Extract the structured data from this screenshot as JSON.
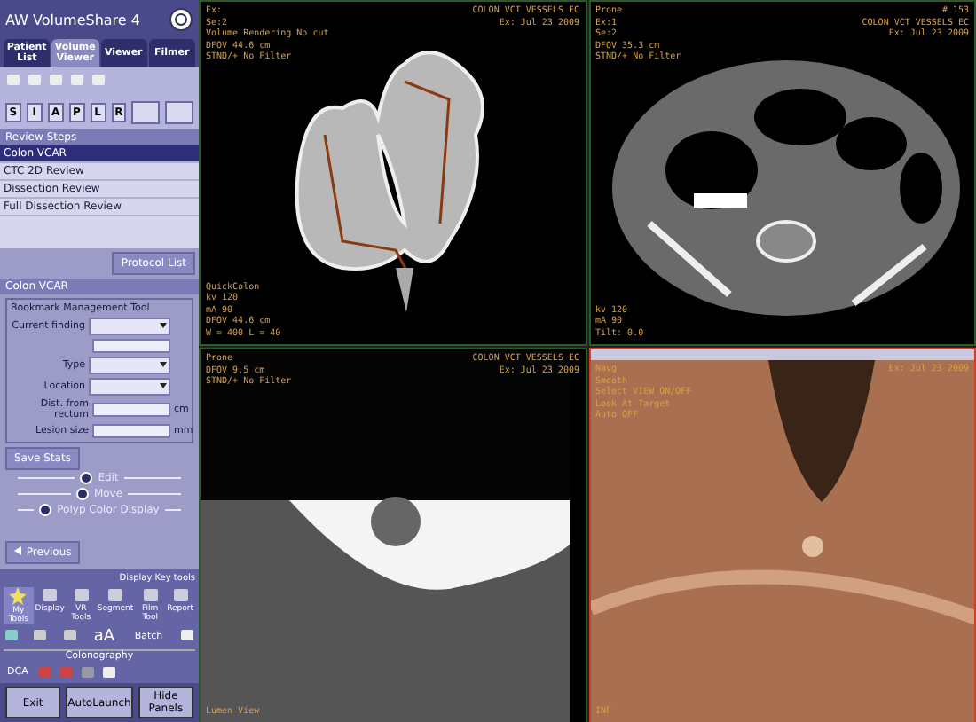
{
  "app": {
    "title": "AW VolumeShare 4"
  },
  "tabs": [
    {
      "label": "Patient List",
      "selected": false
    },
    {
      "label": "Volume Viewer",
      "selected": true
    },
    {
      "label": "Viewer",
      "selected": false
    },
    {
      "label": "Filmer",
      "selected": false
    }
  ],
  "orientation_buttons": [
    {
      "label": "S",
      "selected": false
    },
    {
      "label": "I",
      "selected": false
    },
    {
      "label": "A",
      "selected": false
    },
    {
      "label": "P",
      "selected": false
    },
    {
      "label": "L",
      "selected": false
    },
    {
      "label": "R",
      "selected": false
    }
  ],
  "review_steps": {
    "title": "Review Steps",
    "items": [
      {
        "label": "Colon VCAR",
        "selected": true
      },
      {
        "label": "CTC 2D Review",
        "selected": false
      },
      {
        "label": "Dissection Review",
        "selected": false
      },
      {
        "label": "Full Dissection Review",
        "selected": false
      }
    ]
  },
  "protocol_button": "Protocol List",
  "section_title": "Colon VCAR",
  "bookmark_tool": {
    "title": "Bookmark Management Tool",
    "fields": [
      {
        "kind": "select",
        "label": "Current finding"
      },
      {
        "kind": "input"
      },
      {
        "kind": "select",
        "label": "Type"
      },
      {
        "kind": "select",
        "label": "Location"
      },
      {
        "kind": "input",
        "label": "Dist. from rectum",
        "unit": "cm"
      },
      {
        "kind": "input",
        "label": "Lesion size",
        "unit": "mm"
      }
    ]
  },
  "save_button": "Save Stats",
  "options": [
    {
      "label": "Edit"
    },
    {
      "label": "Move"
    },
    {
      "label": "Polyp Color Display"
    }
  ],
  "previous_button": "Previous",
  "tools": {
    "link": "Display Key tools",
    "items": [
      {
        "label": "My Tools",
        "selected": true
      },
      {
        "label": "Display",
        "selected": false
      },
      {
        "label": "VR Tools",
        "selected": false
      },
      {
        "label": "Segment",
        "selected": false
      },
      {
        "label": "Film Tool",
        "selected": false
      },
      {
        "label": "Report",
        "selected": false
      }
    ],
    "text_buttons": [
      "aA",
      "Batch"
    ],
    "colonography": {
      "title": "Colonography",
      "label": "DCA"
    }
  },
  "footer_buttons": [
    "Exit",
    "AutoLaunch",
    "Hide Panels"
  ],
  "viewports": [
    {
      "kind": "volume",
      "active": false,
      "top_left": [
        "Ex:",
        "Se:2",
        "Volume Rendering  No cut",
        "DFOV 44.6 cm",
        "STND/+ No Filter"
      ],
      "top_right": [
        "COLON VCT VESSELS EC",
        "Ex: Jul 23 2009"
      ],
      "bottom_left": [
        "QuickColon",
        "kv 120",
        "mA 90",
        "DFOV 44.6 cm",
        "W = 400 L = 40"
      ]
    },
    {
      "kind": "axial",
      "active": false,
      "top_left": [
        "Prone",
        "Ex:1",
        "Se:2",
        "DFOV 35.3 cm",
        "STND/+ No Filter"
      ],
      "top_right": [
        "# 153",
        "COLON VCT VESSELS EC",
        "Ex: Jul 23 2009"
      ],
      "bottom_left": [
        "kv 120",
        "mA 90",
        "Tilt: 0.0"
      ]
    },
    {
      "kind": "lumen",
      "active": false,
      "top_left": [
        "Prone",
        "DFOV 9.5 cm",
        "STND/+ No Filter"
      ],
      "top_right": [
        "COLON VCT VESSELS EC",
        "Ex: Jul 23 2009"
      ],
      "bottom_left": [
        "Lumen View"
      ]
    },
    {
      "kind": "endoscopic",
      "active": true,
      "top_left": [
        "Navg",
        "Smooth",
        "Select VIEW ON/OFF",
        "Look At Target",
        "Auto OFF"
      ],
      "top_right": [
        "Ex: Jul 23 2009"
      ],
      "bottom_left": [
        "INF"
      ]
    }
  ]
}
